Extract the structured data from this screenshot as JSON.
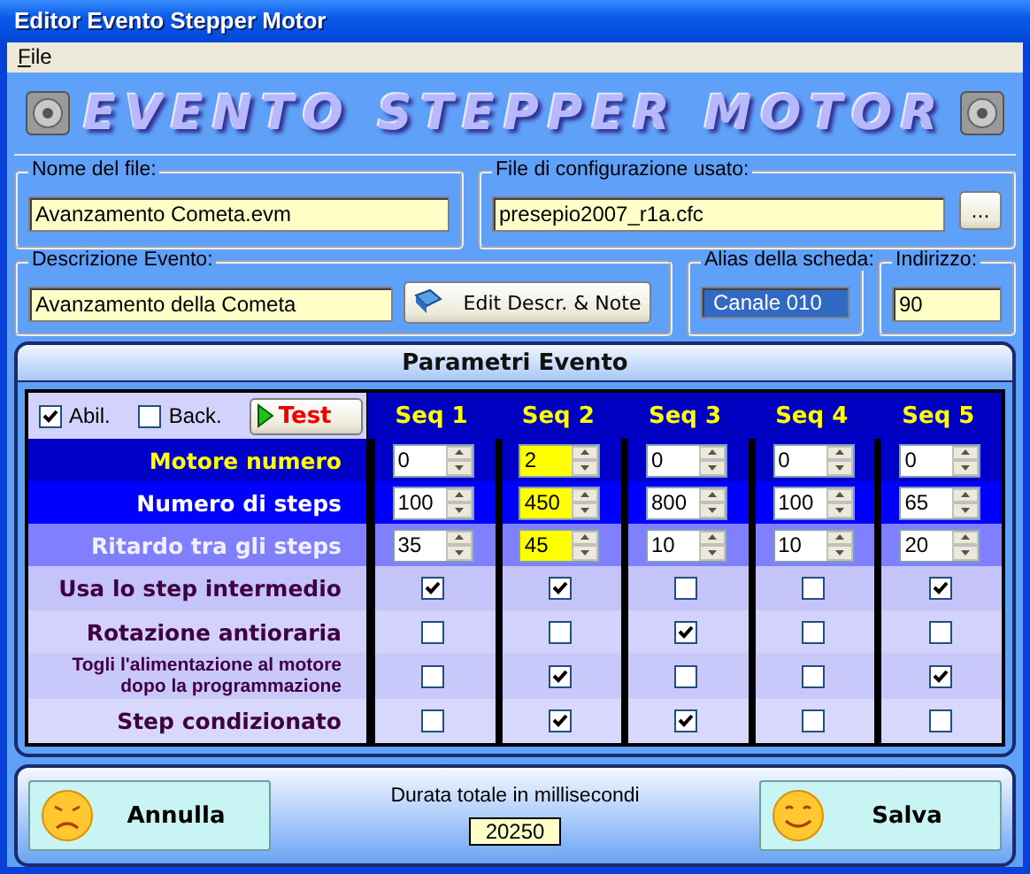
{
  "window": {
    "title": "Editor Evento Stepper Motor"
  },
  "menu": [
    {
      "label": "File"
    }
  ],
  "banner": {
    "title": "EVENTO STEPPER MOTOR"
  },
  "file_name": {
    "label": "Nome del file:",
    "value": "Avanzamento Cometa.evm"
  },
  "config_file": {
    "label": "File di configurazione usato:",
    "value": "presepio2007_r1a.cfc",
    "browse_button": "..."
  },
  "description": {
    "label": "Descrizione Evento:",
    "value": "Avanzamento della Cometa",
    "button": "Edit Descr. & Note"
  },
  "board_alias": {
    "label": "Alias della scheda:",
    "value": "Canale 010"
  },
  "address": {
    "label": "Indirizzo:",
    "value": "90"
  },
  "parameters": {
    "title": "Parametri Evento",
    "enable": {
      "label": "Abil.",
      "checked": true
    },
    "back": {
      "label": "Back.",
      "checked": false
    },
    "test_button": "Test",
    "columns": [
      {
        "label": "Seq 1",
        "highlighted": false
      },
      {
        "label": "Seq 2",
        "highlighted": true
      },
      {
        "label": "Seq 3",
        "highlighted": false
      },
      {
        "label": "Seq 4",
        "highlighted": false
      },
      {
        "label": "Seq 5",
        "highlighted": false
      }
    ],
    "rows": [
      {
        "kind": "spin",
        "label": "Motore numero",
        "values": [
          "0",
          "2",
          "0",
          "0",
          "0"
        ]
      },
      {
        "kind": "spin",
        "label": "Numero di steps",
        "values": [
          "100",
          "450",
          "800",
          "100",
          "65"
        ]
      },
      {
        "kind": "spin",
        "label": "Ritardo tra gli steps",
        "values": [
          "35",
          "45",
          "10",
          "10",
          "20"
        ]
      },
      {
        "kind": "check",
        "label": "Usa lo step intermedio",
        "checks": [
          true,
          true,
          false,
          false,
          true
        ]
      },
      {
        "kind": "check",
        "label": "Rotazione antioraria",
        "checks": [
          false,
          false,
          true,
          false,
          false
        ]
      },
      {
        "kind": "check",
        "label": "Togli l'alimentazione al motore dopo la programmazione",
        "checks": [
          false,
          true,
          false,
          false,
          true
        ]
      },
      {
        "kind": "check",
        "label": "Step condizionato",
        "checks": [
          false,
          true,
          true,
          false,
          false
        ]
      }
    ]
  },
  "footer": {
    "cancel_button": "Annulla",
    "total_label": "Durata totale in millisecondi",
    "total_value": "20250",
    "save_button": "Salva"
  }
}
